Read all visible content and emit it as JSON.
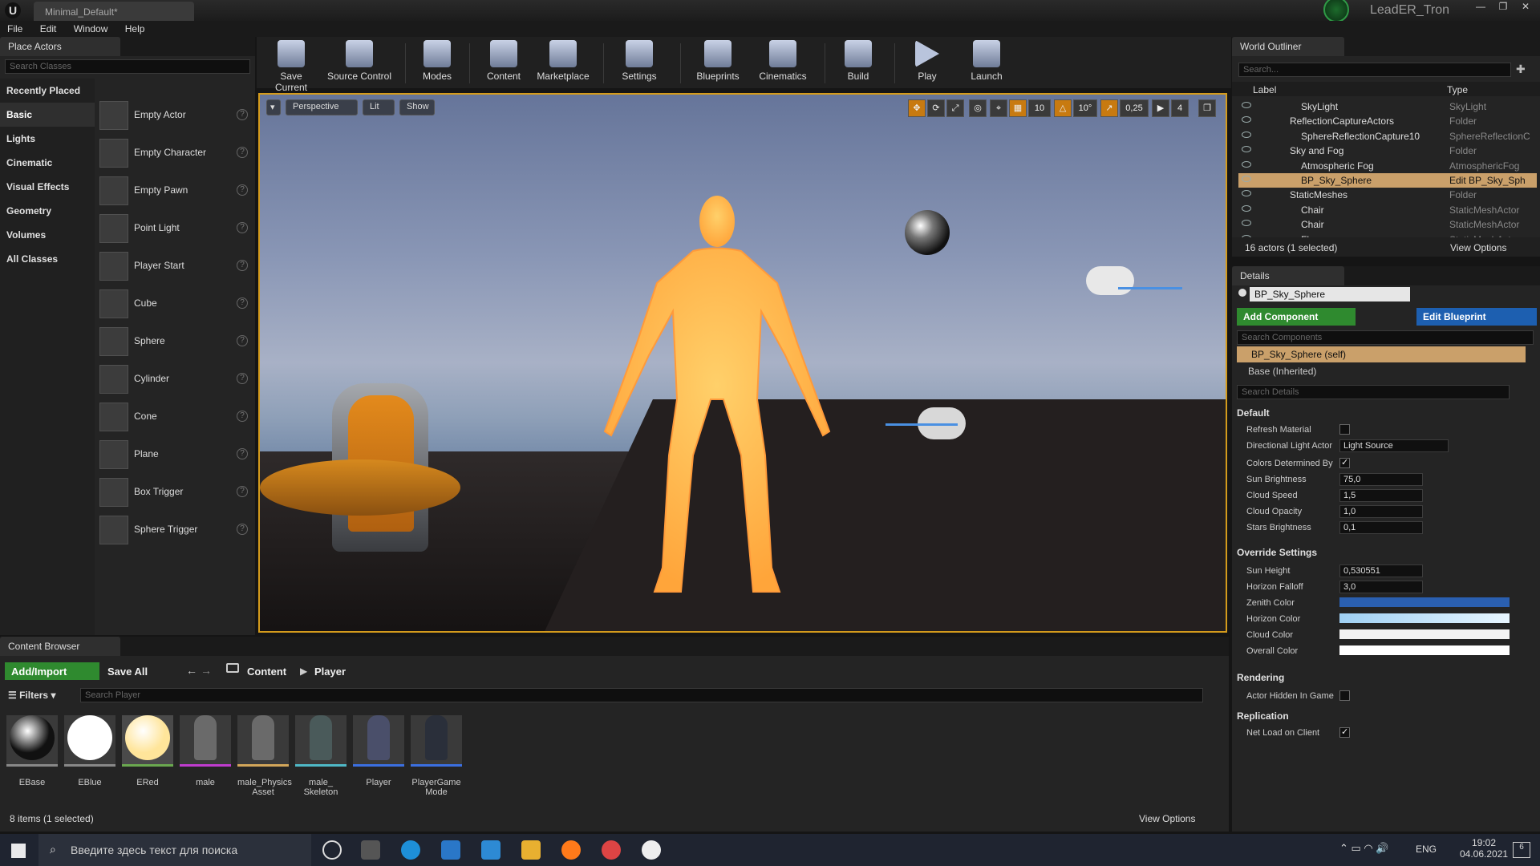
{
  "window": {
    "doc_tab": "Minimal_Default*",
    "user": "LeadER_Tron",
    "menu": [
      "File",
      "Edit",
      "Window",
      "Help"
    ]
  },
  "place_actors": {
    "tab": "Place Actors",
    "search_placeholder": "Search Classes",
    "categories": [
      "Recently Placed",
      "Basic",
      "Lights",
      "Cinematic",
      "Visual Effects",
      "Geometry",
      "Volumes",
      "All Classes"
    ],
    "selected_category": "Basic",
    "actors": [
      "Empty Actor",
      "Empty Character",
      "Empty Pawn",
      "Point Light",
      "Player Start",
      "Cube",
      "Sphere",
      "Cylinder",
      "Cone",
      "Plane",
      "Box Trigger",
      "Sphere Trigger"
    ]
  },
  "toolbar": {
    "buttons": [
      "Save Current",
      "Source Control",
      "Modes",
      "Content",
      "Marketplace",
      "Settings",
      "Blueprints",
      "Cinematics",
      "Build",
      "Play",
      "Launch"
    ]
  },
  "viewport": {
    "perspective": "Perspective",
    "lit": "Lit",
    "show": "Show",
    "grid_snap": "10",
    "rot_snap": "10°",
    "scale_snap": "0,25",
    "cam_speed": "4"
  },
  "outliner": {
    "tab": "World Outliner",
    "search_placeholder": "Search...",
    "col_label": "Label",
    "col_type": "Type",
    "rows": [
      {
        "label": "SkyLight",
        "type": "SkyLight",
        "indent": 3
      },
      {
        "label": "ReflectionCaptureActors",
        "type": "Folder",
        "indent": 2
      },
      {
        "label": "SphereReflectionCapture10",
        "type": "SphereReflectionC",
        "indent": 3
      },
      {
        "label": "Sky and Fog",
        "type": "Folder",
        "indent": 2
      },
      {
        "label": "Atmospheric Fog",
        "type": "AtmosphericFog",
        "indent": 3
      },
      {
        "label": "BP_Sky_Sphere",
        "type": "Edit BP_Sky_Sph",
        "indent": 3,
        "selected": true
      },
      {
        "label": "StaticMeshes",
        "type": "Folder",
        "indent": 2
      },
      {
        "label": "Chair",
        "type": "StaticMeshActor",
        "indent": 3
      },
      {
        "label": "Chair",
        "type": "StaticMeshActor",
        "indent": 3
      },
      {
        "label": "Floor",
        "type": "StaticMeshActor",
        "indent": 3
      }
    ],
    "status": "16 actors (1 selected)",
    "view_options": "View Options"
  },
  "details": {
    "tab": "Details",
    "object_name": "BP_Sky_Sphere",
    "add_component": "Add Component",
    "edit_blueprint": "Edit Blueprint",
    "search_components": "Search Components",
    "self": "BP_Sky_Sphere (self)",
    "base": "Base (Inherited)",
    "search_details": "Search Details",
    "sec_default": "Default",
    "refresh_material": "Refresh Material",
    "dir_light_label": "Directional Light Actor",
    "dir_light_value": "Light Source",
    "colors_determined": "Colors Determined By",
    "sun_brightness_label": "Sun Brightness",
    "sun_brightness": "75,0",
    "cloud_speed_label": "Cloud Speed",
    "cloud_speed": "1,5",
    "cloud_opacity_label": "Cloud Opacity",
    "cloud_opacity": "1,0",
    "stars_brightness_label": "Stars Brightness",
    "stars_brightness": "0,1",
    "sec_override": "Override Settings",
    "sun_height_label": "Sun Height",
    "sun_height": "0,530551",
    "horizon_falloff_label": "Horizon Falloff",
    "horizon_falloff": "3,0",
    "zenith_color": "Zenith Color",
    "horizon_color": "Horizon Color",
    "cloud_color": "Cloud Color",
    "overall_color": "Overall Color",
    "sec_rendering": "Rendering",
    "actor_hidden": "Actor Hidden In Game",
    "sec_replication": "Replication",
    "net_load": "Net Load on Client"
  },
  "content_browser": {
    "tab": "Content Browser",
    "add_import": "Add/Import",
    "save_all": "Save All",
    "path": [
      "Content",
      "Player"
    ],
    "filters": "Filters",
    "search_placeholder": "Search Player",
    "assets": [
      {
        "name": "EBase",
        "color": "#111111",
        "bar": "#888888"
      },
      {
        "name": "EBlue",
        "color": "#ffffff",
        "bar": "#888888"
      },
      {
        "name": "ERed",
        "color": "#ffe59a",
        "bar": "#6aa84f"
      },
      {
        "name": "male",
        "color": "#6a6a6a",
        "bar": "#c03ccf"
      },
      {
        "name": "male_Physics Asset",
        "color": "#6a6a6a",
        "bar": "#d2a65a"
      },
      {
        "name": "male_ Skeleton",
        "color": "#4a5a5a",
        "bar": "#4fb8c6"
      },
      {
        "name": "Player",
        "color": "#4a4f6a",
        "bar": "#3b6fe0"
      },
      {
        "name": "PlayerGame Mode",
        "color": "#2a2f3a",
        "bar": "#3b6fe0"
      }
    ],
    "status": "8 items (1 selected)",
    "view_options": "View Options"
  },
  "taskbar": {
    "search_text": "Введите здесь текст для поиска",
    "lang": "ENG",
    "time": "19:02",
    "date": "04.06.2021",
    "notif": "6"
  }
}
